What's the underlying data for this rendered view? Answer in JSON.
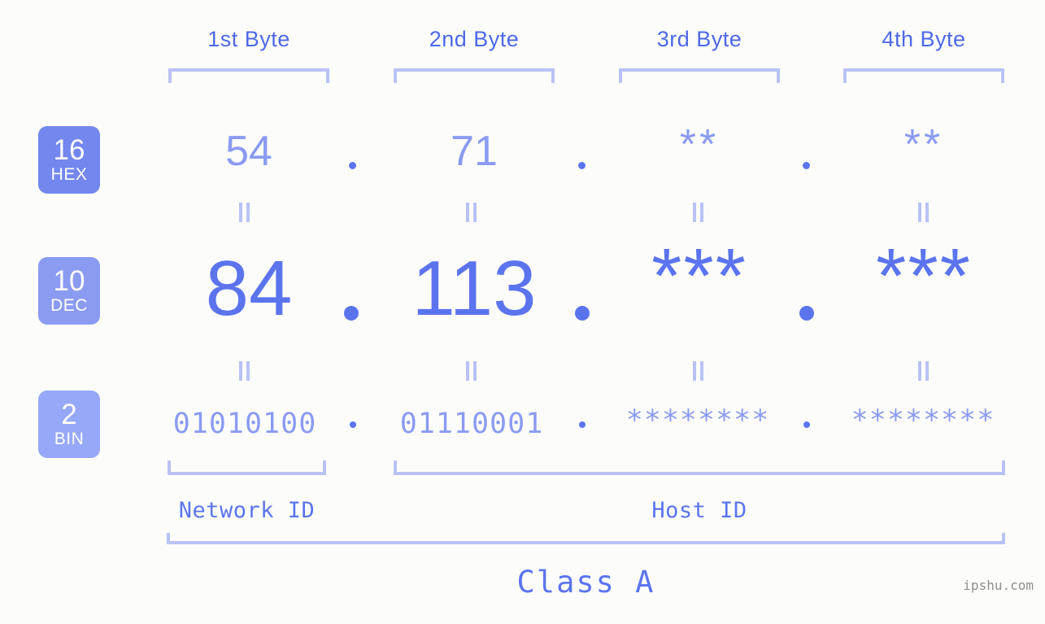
{
  "watermark": "ipshu.com",
  "colors": {
    "background": "#fcfdfa",
    "accent_strong": "#5b74ee",
    "accent_mid": "#8b9bf2",
    "accent_light": "#b9c2f6",
    "badge_hex": "#7387ee",
    "badge_dec": "#8b9bf2",
    "badge_bin": "#96a8f7",
    "watermark": "#8e8e8e"
  },
  "byte_headers": [
    {
      "label": "1st Byte"
    },
    {
      "label": "2nd Byte"
    },
    {
      "label": "3rd Byte"
    },
    {
      "label": "4th Byte"
    }
  ],
  "radix_badges": [
    {
      "number": "16",
      "label": "HEX"
    },
    {
      "number": "10",
      "label": "DEC"
    },
    {
      "number": "2",
      "label": "BIN"
    }
  ],
  "rows": {
    "hex": {
      "radix": "16",
      "radix_label": "HEX",
      "values": [
        "54",
        "71",
        "**",
        "**"
      ],
      "separator": "."
    },
    "dec": {
      "radix": "10",
      "radix_label": "DEC",
      "values": [
        "84",
        "113",
        "***",
        "***"
      ],
      "separator": "."
    },
    "bin": {
      "radix": "2",
      "radix_label": "BIN",
      "values": [
        "01010100",
        "01110001",
        "********",
        "********"
      ],
      "separator": "."
    }
  },
  "equality_symbol": "||",
  "id_labels": {
    "network": "Network ID",
    "host": "Host ID"
  },
  "class_label": "Class A"
}
